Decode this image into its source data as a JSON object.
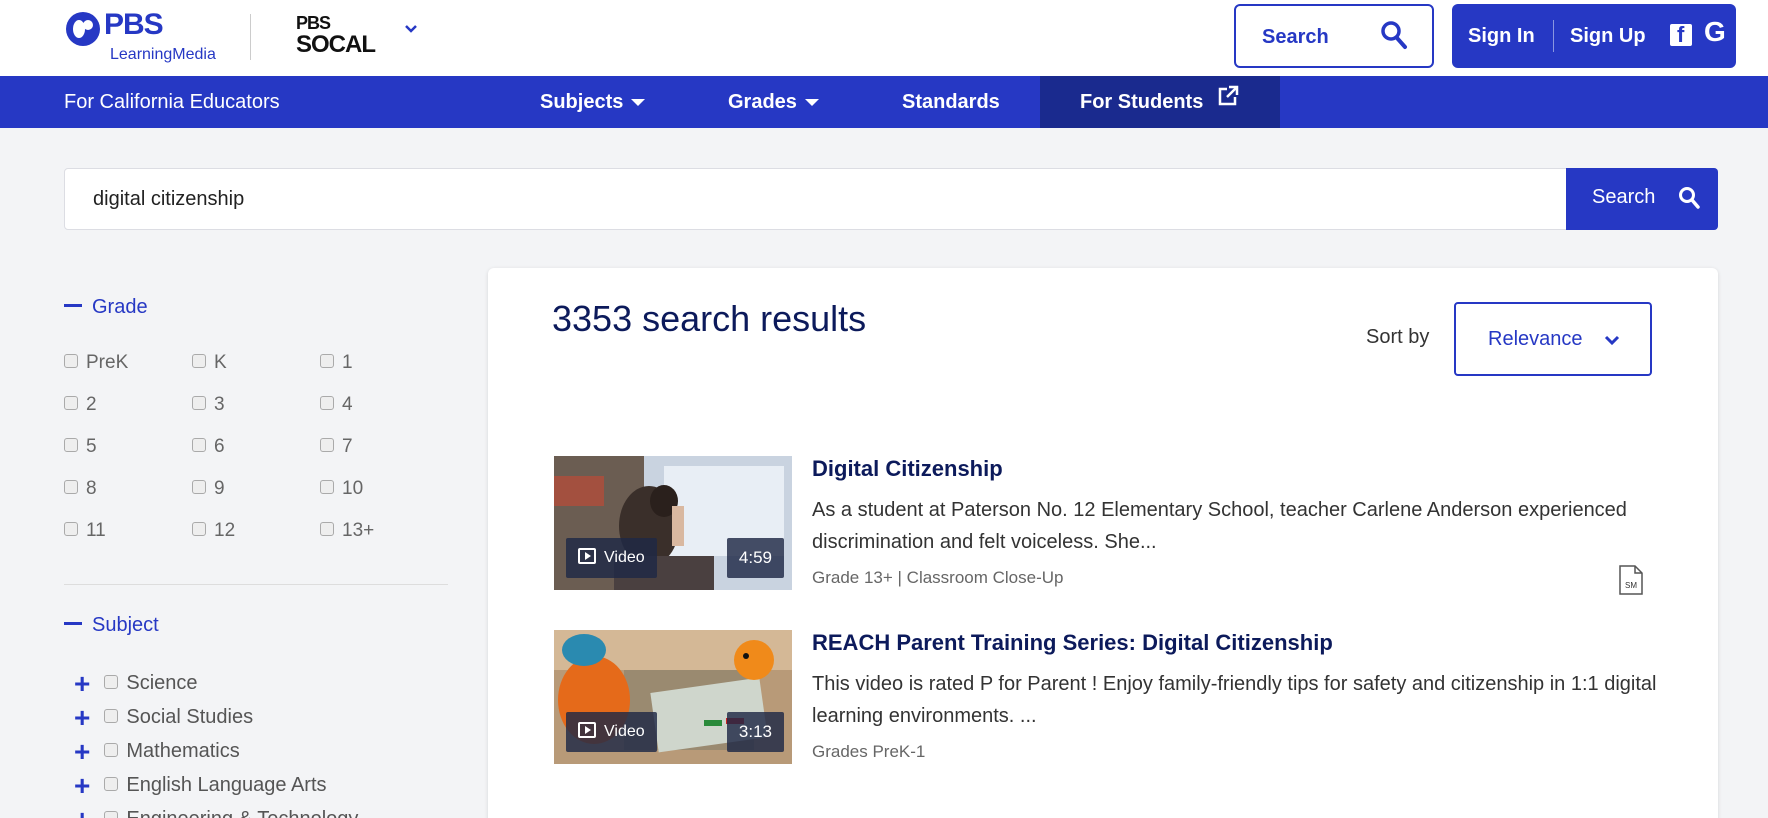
{
  "header": {
    "logo_text": "PBS",
    "logo_sub": "LearningMedia",
    "station_line1": "PBS",
    "station_line2": "SOCAL",
    "search_label": "Search",
    "sign_in": "Sign In",
    "sign_up": "Sign Up",
    "facebook_letter": "f",
    "google_letter": "G"
  },
  "nav": {
    "region": "For California Educators",
    "items": [
      {
        "label": "Subjects"
      },
      {
        "label": "Grades"
      },
      {
        "label": "Standards"
      },
      {
        "label": "For Students"
      }
    ]
  },
  "search": {
    "value": "digital citizenship",
    "button_label": "Search"
  },
  "sidebar": {
    "grade_header": "Grade",
    "grades": [
      "PreK",
      "K",
      "1",
      "2",
      "3",
      "4",
      "5",
      "6",
      "7",
      "8",
      "9",
      "10",
      "11",
      "12",
      "13+"
    ],
    "subject_header": "Subject",
    "subjects": [
      "Science",
      "Social Studies",
      "Mathematics",
      "English Language Arts",
      "Engineering & Technology"
    ]
  },
  "results": {
    "count_text": "3353 search results",
    "sort_label": "Sort by",
    "sort_value": "Relevance",
    "items": [
      {
        "type": "Video",
        "duration": "4:59",
        "title": "Digital Citizenship",
        "description": "As a student at Paterson No. 12 Elementary School, teacher Carlene Anderson experienced discrimination and felt voiceless. She...",
        "meta": "Grade 13+  |  Classroom Close-Up",
        "badge": "SM"
      },
      {
        "type": "Video",
        "duration": "3:13",
        "title": "REACH Parent Training Series: Digital Citizenship",
        "description": "This video is rated P for Parent ! Enjoy family-friendly tips for safety and citizenship in 1:1 digital learning environments. ...",
        "meta": "Grades PreK-1"
      }
    ]
  },
  "colors": {
    "brand_blue": "#2638c4",
    "nav_active": "#1a2a8e",
    "title_navy": "#0c1a5b"
  }
}
